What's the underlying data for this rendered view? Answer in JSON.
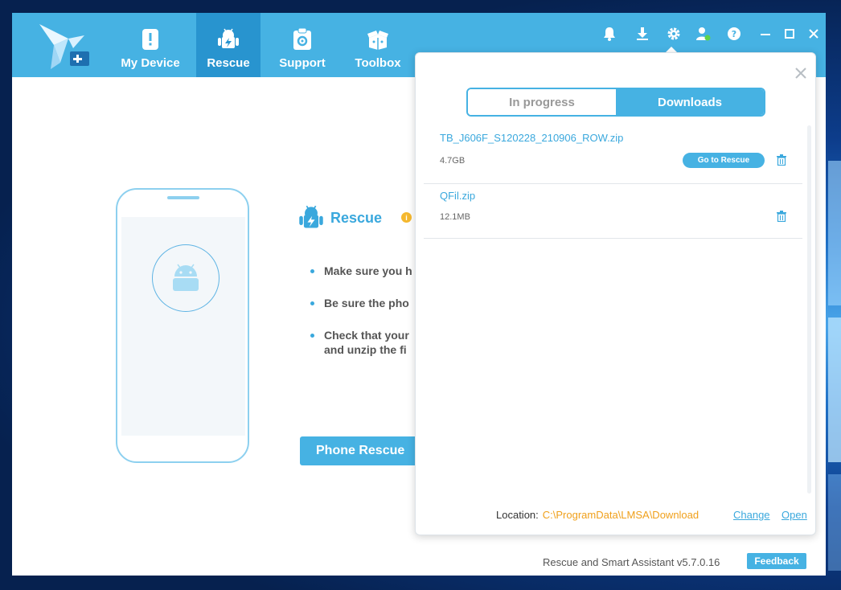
{
  "nav": {
    "items": [
      {
        "label": "My Device",
        "icon": "phone-alert-icon"
      },
      {
        "label": "Rescue",
        "icon": "android-bolt-icon",
        "active": true
      },
      {
        "label": "Support",
        "icon": "clipboard-gear-icon"
      },
      {
        "label": "Toolbox",
        "icon": "toolbox-icon"
      }
    ]
  },
  "window_icons": [
    "bell-icon",
    "download-icon",
    "gear-icon",
    "user-icon",
    "help-icon",
    "minimize-icon",
    "maximize-icon",
    "close-icon"
  ],
  "rescue": {
    "title": "Rescue",
    "bullets": [
      "Make sure you h",
      "Be sure the pho",
      "Check that your"
    ],
    "bullet3_line2": "and unzip the fi",
    "button_label": "Phone Rescue"
  },
  "popup": {
    "tabs": [
      {
        "label": "In progress",
        "active": false
      },
      {
        "label": "Downloads",
        "active": true
      }
    ],
    "items": [
      {
        "name": "TB_J606F_S120228_210906_ROW.zip",
        "size": "4.7GB",
        "action": "Go to Rescue"
      },
      {
        "name": "QFil.zip",
        "size": "12.1MB"
      }
    ],
    "location_label": "Location:",
    "location_path": "C:\\ProgramData\\LMSA\\Download",
    "change_label": "Change",
    "open_label": "Open"
  },
  "footer": {
    "version": "Rescue and Smart Assistant v5.7.0.16",
    "feedback_label": "Feedback"
  },
  "colors": {
    "accent": "#46b2e3",
    "accent_dark": "#2894cf",
    "path_orange": "#f0a01b"
  }
}
